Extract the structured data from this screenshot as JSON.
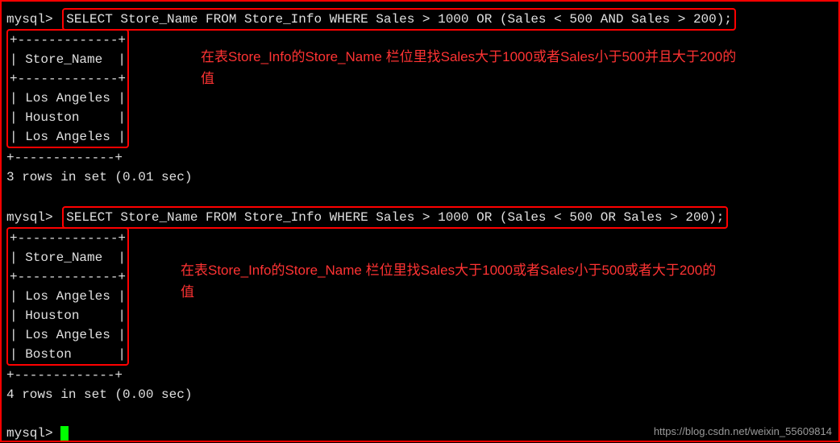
{
  "block1": {
    "prompt": "mysql>",
    "sql": "SELECT Store_Name FROM Store_Info WHERE Sales > 1000 OR (Sales < 500 AND Sales > 200);",
    "table_header": "Store_Name",
    "rows": [
      "Los Angeles",
      "Houston",
      "Los Angeles"
    ],
    "border_line": "+-------------+",
    "status": "3 rows in set (0.01 sec)",
    "annotation": "在表Store_Info的Store_Name 栏位里找Sales大于1000或者Sales小于500并且大于200的值"
  },
  "block2": {
    "prompt": "mysql>",
    "sql": "SELECT Store_Name FROM Store_Info WHERE Sales > 1000 OR (Sales < 500 OR Sales > 200);",
    "table_header": "Store_Name",
    "rows": [
      "Los Angeles",
      "Houston",
      "Los Angeles",
      "Boston"
    ],
    "border_line": "+-------------+",
    "status": "4 rows in set (0.00 sec)",
    "annotation": "在表Store_Info的Store_Name 栏位里找Sales大于1000或者Sales小于500或者大于200的值"
  },
  "final_prompt": "mysql>",
  "watermark": "https://blog.csdn.net/weixin_55609814"
}
